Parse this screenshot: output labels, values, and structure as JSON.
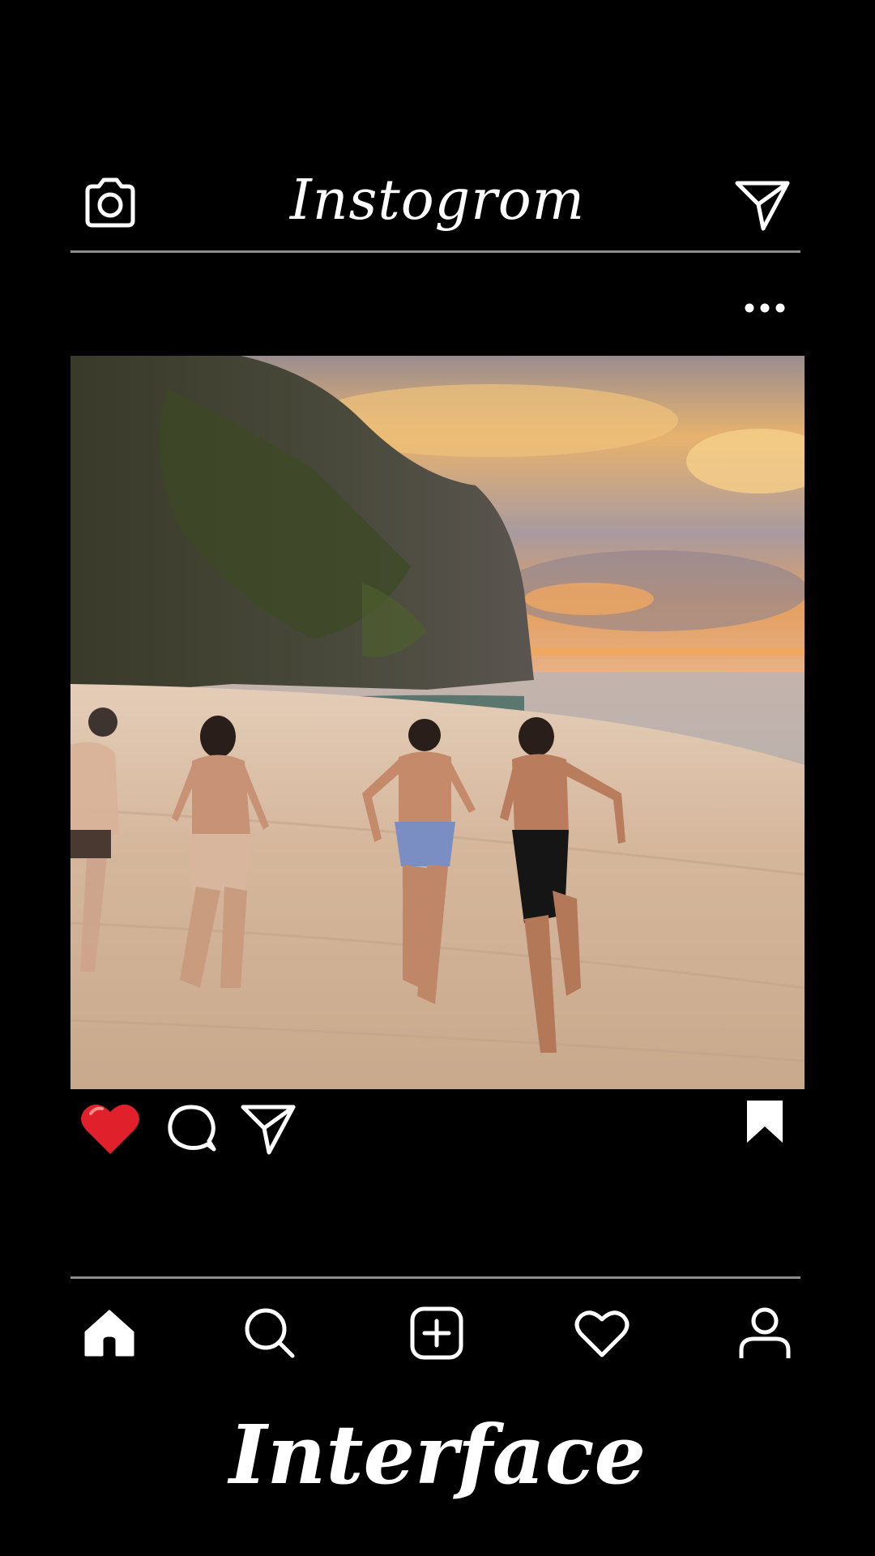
{
  "header": {
    "app_title": "Instogrom",
    "camera_icon": "camera-icon",
    "direct_icon": "paper-plane-icon"
  },
  "post": {
    "more_icon": "more-options-icon",
    "image_alt": "Friends running on a sandy beach toward the sea at sunset beside a tall cliff",
    "actions": {
      "like_icon": "heart-filled-icon",
      "like_color": "#e0202a",
      "comment_icon": "comment-icon",
      "share_icon": "paper-plane-icon",
      "save_icon": "bookmark-filled-icon"
    }
  },
  "bottom_nav": {
    "items": [
      {
        "name": "home",
        "icon": "home-filled-icon"
      },
      {
        "name": "search",
        "icon": "search-icon"
      },
      {
        "name": "add",
        "icon": "add-post-icon"
      },
      {
        "name": "activity",
        "icon": "heart-outline-icon"
      },
      {
        "name": "profile",
        "icon": "person-icon"
      }
    ]
  },
  "caption": "Interface",
  "colors": {
    "background": "#000000",
    "foreground": "#ffffff",
    "divider": "#8c8c8c"
  }
}
